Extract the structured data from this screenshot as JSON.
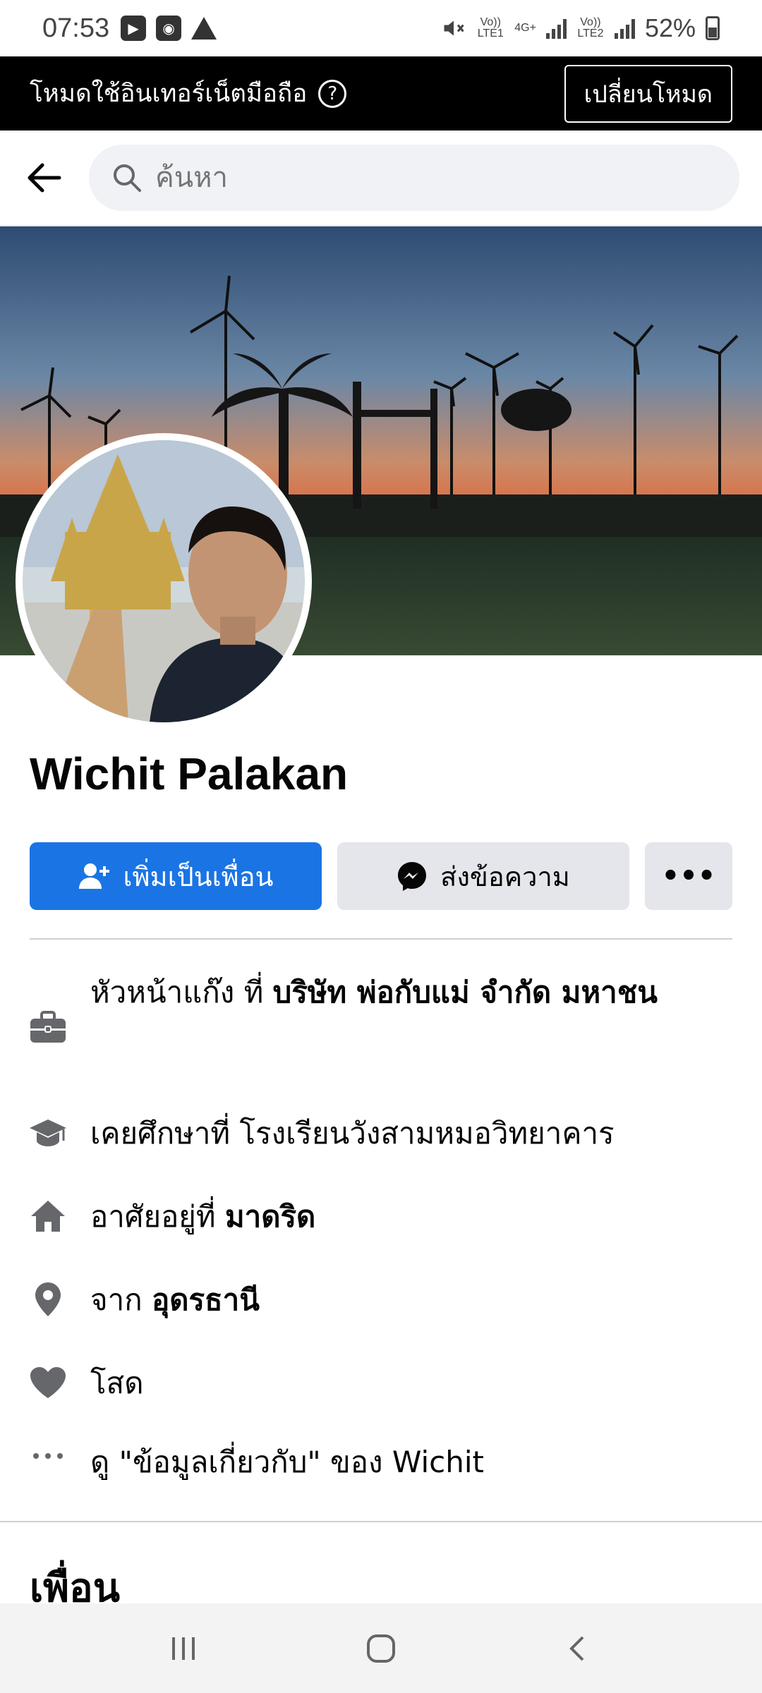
{
  "status_bar": {
    "time": "07:53",
    "sim1": "Vo)) LTE1",
    "net": "4G+",
    "sim2": "Vo)) LTE2",
    "battery": "52%"
  },
  "mode_bar": {
    "text": "โหมดใช้อินเทอร์เน็ตมือถือ",
    "help": "?",
    "switch_label": "เปลี่ยนโหมด"
  },
  "search": {
    "placeholder": "ค้นหา"
  },
  "profile": {
    "name": "Wichit Palakan"
  },
  "actions": {
    "add_friend": "เพิ่มเป็นเพื่อน",
    "message": "ส่งข้อความ",
    "more": "•••"
  },
  "info": {
    "work_prefix": "หัวหน้าแก๊ง ที่ ",
    "work_place": "บริษัท พ่อกับแม่ จำกัด มหาชน",
    "education": "เคยศึกษาที่ โรงเรียนวังสามหมอวิทยาคาร",
    "lives_prefix": "อาศัยอยู่ที่ ",
    "lives_place": "มาดริด",
    "from_prefix": "จาก ",
    "from_place": "อุดรธานี",
    "relationship": "โสด",
    "about_link": "ดู \"ข้อมูลเกี่ยวกับ\" ของ Wichit"
  },
  "friends": {
    "title": "เพื่อน"
  },
  "colors": {
    "primary": "#1b74e4",
    "icon_gray": "#65676b"
  }
}
